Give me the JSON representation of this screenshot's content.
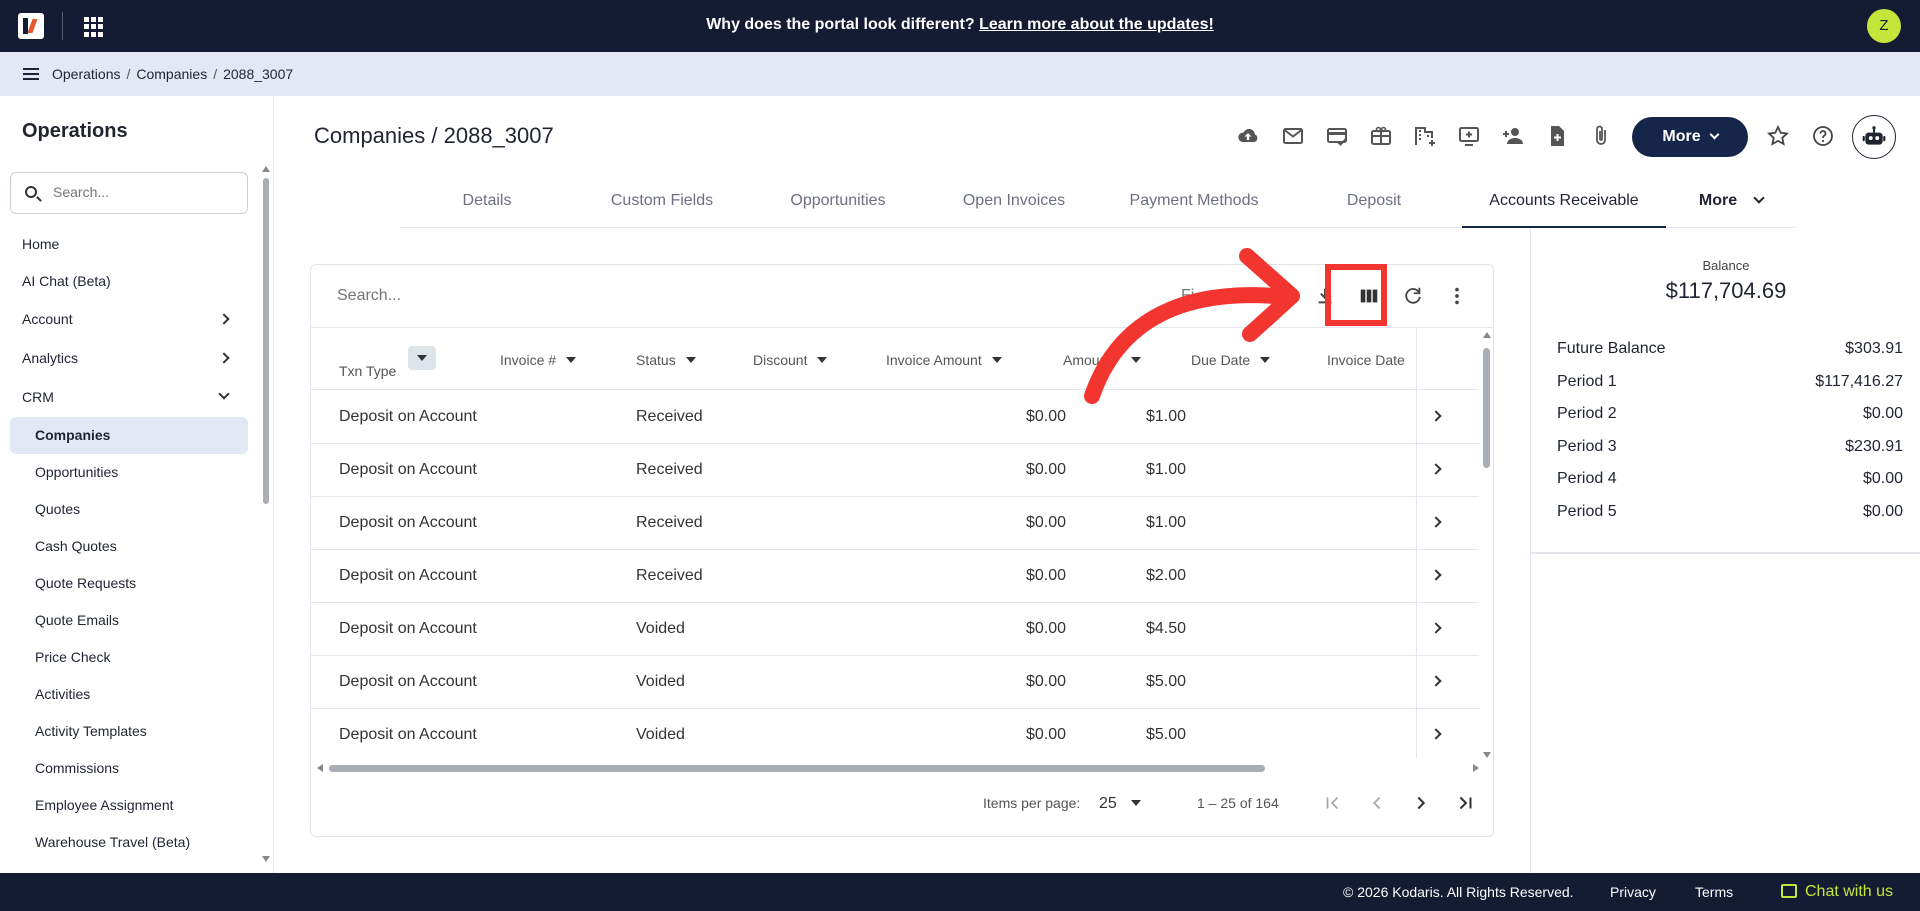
{
  "banner": {
    "text": "Why does the portal look different?",
    "link": "Learn more about the updates!"
  },
  "user": {
    "initial": "Z"
  },
  "breadcrumb": [
    "Operations",
    "Companies",
    "2088_3007"
  ],
  "sidebar": {
    "title": "Operations",
    "search_placeholder": "Search...",
    "items": [
      {
        "label": "Home"
      },
      {
        "label": "AI Chat (Beta)"
      },
      {
        "label": "Account"
      },
      {
        "label": "Analytics"
      },
      {
        "label": "CRM"
      },
      {
        "label": "Companies"
      },
      {
        "label": "Opportunities"
      },
      {
        "label": "Quotes"
      },
      {
        "label": "Cash Quotes"
      },
      {
        "label": "Quote Requests"
      },
      {
        "label": "Quote Emails"
      },
      {
        "label": "Price Check"
      },
      {
        "label": "Activities"
      },
      {
        "label": "Activity Templates"
      },
      {
        "label": "Commissions"
      },
      {
        "label": "Employee Assignment"
      },
      {
        "label": "Warehouse Travel (Beta)"
      }
    ]
  },
  "page": {
    "title": "Companies / 2088_3007",
    "more_label": "More"
  },
  "tabs": [
    {
      "label": "Details"
    },
    {
      "label": "Custom Fields"
    },
    {
      "label": "Opportunities"
    },
    {
      "label": "Open Invoices"
    },
    {
      "label": "Payment Methods"
    },
    {
      "label": "Deposit"
    },
    {
      "label": "Accounts Receivable"
    },
    {
      "label": "More"
    }
  ],
  "table": {
    "search_placeholder": "Search...",
    "filter_label": "Fi",
    "columns": [
      "Txn Type",
      "Invoice #",
      "Status",
      "Discount",
      "Invoice Amount",
      "Amount",
      "Due Date",
      "Invoice Date"
    ],
    "rows": [
      {
        "txn_type": "Deposit on Account",
        "status": "Received",
        "invoice_amount": "$0.00",
        "amount": "$1.00"
      },
      {
        "txn_type": "Deposit on Account",
        "status": "Received",
        "invoice_amount": "$0.00",
        "amount": "$1.00"
      },
      {
        "txn_type": "Deposit on Account",
        "status": "Received",
        "invoice_amount": "$0.00",
        "amount": "$1.00"
      },
      {
        "txn_type": "Deposit on Account",
        "status": "Received",
        "invoice_amount": "$0.00",
        "amount": "$2.00"
      },
      {
        "txn_type": "Deposit on Account",
        "status": "Voided",
        "invoice_amount": "$0.00",
        "amount": "$4.50"
      },
      {
        "txn_type": "Deposit on Account",
        "status": "Voided",
        "invoice_amount": "$0.00",
        "amount": "$5.00"
      },
      {
        "txn_type": "Deposit on Account",
        "status": "Voided",
        "invoice_amount": "$0.00",
        "amount": "$5.00"
      }
    ],
    "pager": {
      "items_per_page_label": "Items per page:",
      "items_per_page": "25",
      "range": "1 – 25 of 164"
    }
  },
  "balance": {
    "label": "Balance",
    "value": "$117,704.69",
    "rows": [
      {
        "label": "Future Balance",
        "value": "$303.91"
      },
      {
        "label": "Period 1",
        "value": "$117,416.27"
      },
      {
        "label": "Period 2",
        "value": "$0.00"
      },
      {
        "label": "Period 3",
        "value": "$230.91"
      },
      {
        "label": "Period 4",
        "value": "$0.00"
      },
      {
        "label": "Period 5",
        "value": "$0.00"
      }
    ]
  },
  "footer": {
    "copyright": "© 2026 Kodaris. All Rights Reserved.",
    "privacy": "Privacy",
    "terms": "Terms",
    "chat": "Chat with us"
  },
  "colors": {
    "navy": "#141c33",
    "accent_lime": "#c6e53b",
    "annotation_red": "#f2362f",
    "button_navy": "#16264a"
  }
}
